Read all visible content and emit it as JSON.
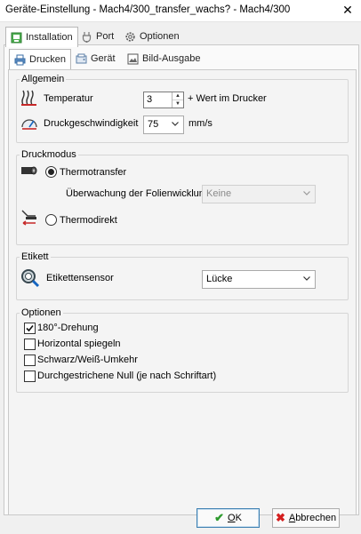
{
  "window": {
    "title": "Geräte-Einstellung -   Mach4/300_transfer_wachs?   - Mach4/300",
    "close_label": "✕"
  },
  "outer_tabs": [
    {
      "label": "Installation",
      "icon": "printer-installation-icon",
      "active": true
    },
    {
      "label": "Port",
      "icon": "port-icon",
      "active": false
    },
    {
      "label": "Optionen",
      "icon": "gear-icon",
      "active": false
    }
  ],
  "inner_tabs": [
    {
      "label": "Drucken",
      "icon": "printer-icon",
      "active": true
    },
    {
      "label": "Gerät",
      "icon": "device-icon",
      "active": false
    },
    {
      "label": "Bild-Ausgabe",
      "icon": "image-output-icon",
      "active": false
    }
  ],
  "allgemein": {
    "legend": "Allgemein",
    "temperatur_label": "Temperatur",
    "temperatur_value": "3",
    "temperatur_hint": "+ Wert im Drucker",
    "speed_label": "Druckgeschwindigkeit",
    "speed_value": "75",
    "speed_unit": "mm/s"
  },
  "druckmodus": {
    "legend": "Druckmodus",
    "thermotransfer_label": "Thermotransfer",
    "thermotransfer_selected": true,
    "foil_label": "Überwachung der Folienwicklung",
    "foil_value": "Keine",
    "thermodirekt_label": "Thermodirekt",
    "thermodirekt_selected": false
  },
  "etikett": {
    "legend": "Etikett",
    "sensor_label": "Etikettensensor",
    "sensor_value": "Lücke"
  },
  "optionen": {
    "legend": "Optionen",
    "items": [
      {
        "label": "180°-Drehung",
        "checked": true
      },
      {
        "label": "Horizontal spiegeln",
        "checked": false
      },
      {
        "label": "Schwarz/Weiß-Umkehr",
        "checked": false
      },
      {
        "label": "Durchgestrichene Null (je nach Schriftart)",
        "checked": false
      }
    ]
  },
  "buttons": {
    "ok_first": "O",
    "ok_rest": "K",
    "cancel_first": "A",
    "cancel_rest": "bbrechen"
  },
  "colors": {
    "ok_accent": "#2e9a2e",
    "cancel_accent": "#d42020",
    "focus_border": "#3c7fb1"
  }
}
